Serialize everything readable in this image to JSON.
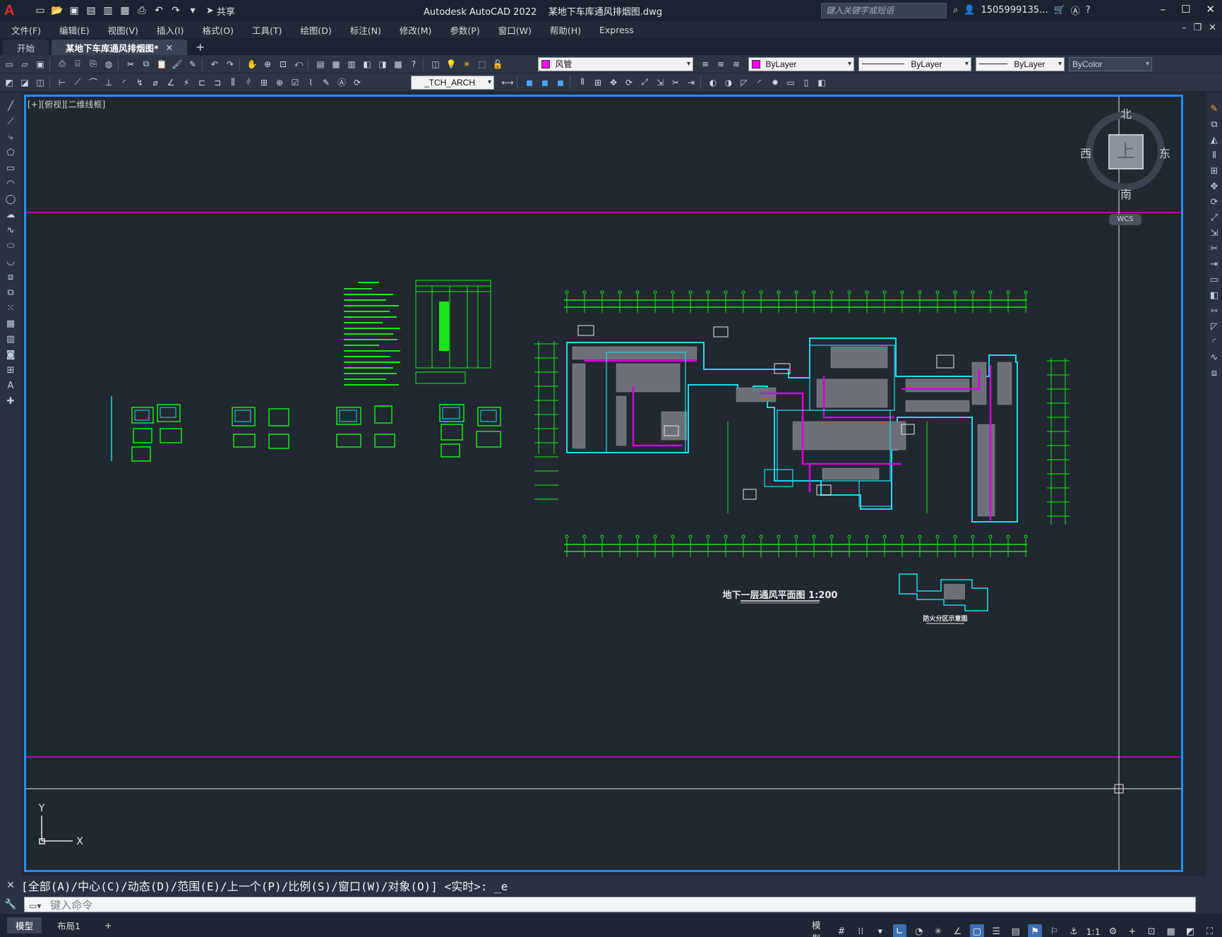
{
  "titlebar": {
    "logo": "A",
    "title": "Autodesk AutoCAD 2022    某地下车库通风排烟图.dwg",
    "share": "共享",
    "search_placeholder": "键入关键字或短语",
    "user": "1505999135...",
    "help": "?"
  },
  "menu": [
    "文件(F)",
    "编辑(E)",
    "视图(V)",
    "插入(I)",
    "格式(O)",
    "工具(T)",
    "绘图(D)",
    "标注(N)",
    "修改(M)",
    "参数(P)",
    "窗口(W)",
    "帮助(H)",
    "Express"
  ],
  "tabs": {
    "start": "开始",
    "active": "某地下车库通风排烟图*",
    "close": "✕",
    "add": "+"
  },
  "toolbar": {
    "layer": "风管",
    "layer_color": "#ff00ff",
    "color": "ByLayer",
    "color_swatch": "#ff00ff",
    "linetype": "ByLayer",
    "lineweight": "ByLayer",
    "plotstyle": "ByColor",
    "textstyle": "_TCH_ARCH"
  },
  "viewport": {
    "label": "[+][俯视][二维线框]",
    "drawing_title": "地下一层通风平面图    1:200",
    "detail_title": "防火分区示意图",
    "ucs_y": "Y",
    "ucs_x": "X"
  },
  "compass": {
    "north": "北",
    "south": "南",
    "east": "东",
    "west": "西",
    "face": "上",
    "wcs": "WCS"
  },
  "command": {
    "history": "[全部(A)/中心(C)/动态(D)/范围(E)/上一个(P)/比例(S)/窗口(W)/对象(O)] <实时>: _e",
    "placeholder": "键入命令"
  },
  "status": {
    "tab_model": "模型",
    "tab_layout1": "布局1",
    "add": "+",
    "model_label": "模型",
    "scale": "1:1"
  },
  "colors": {
    "drawing_green": "#19e619",
    "drawing_cyan": "#1fd8e8",
    "drawing_magenta": "#d800d8",
    "viewport_border": "#1e8fff"
  }
}
